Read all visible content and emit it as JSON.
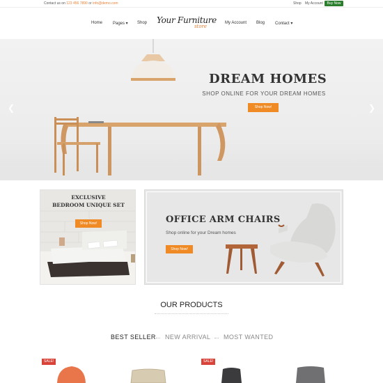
{
  "topbar": {
    "contact_prefix": "Contact us on",
    "phone": "123 456 7890",
    "or": "or",
    "email": "info@demo.com",
    "links": [
      "Shop",
      "My Account"
    ],
    "buy_now": "Buy Now"
  },
  "nav": {
    "items": [
      "Home",
      "Pages ▾",
      "Shop",
      "My Account",
      "Blog",
      "Contact ▾"
    ],
    "logo_main": "Your Furniture",
    "logo_sub": "store"
  },
  "hero": {
    "title": "DREAM HOMES",
    "subtitle": "SHOP ONLINE FOR YOUR DREAM HOMES",
    "button": "Shop Now!",
    "prev_icon": "chevron-left-icon",
    "next_icon": "chevron-right-icon"
  },
  "promo_left": {
    "title_line1": "EXCLUSIVE",
    "title_line2": "BEDROOM UNIQUE SET",
    "button": "Shop Now!"
  },
  "promo_right": {
    "title": "OFFICE ARM CHAIRS",
    "subtitle": "Shop online for your Dream homes",
    "button": "Shop Now!"
  },
  "products": {
    "heading": "OUR PRODUCTS",
    "tabs": [
      "BEST SELLER",
      "NEW ARRIVAL",
      "MOST WANTED"
    ],
    "active_tab": "BEST SELLER",
    "sale_badge": "SALE!"
  },
  "colors": {
    "accent": "#f08a24",
    "buy_green": "#2a7d2a",
    "sale_red": "#d9443a"
  }
}
